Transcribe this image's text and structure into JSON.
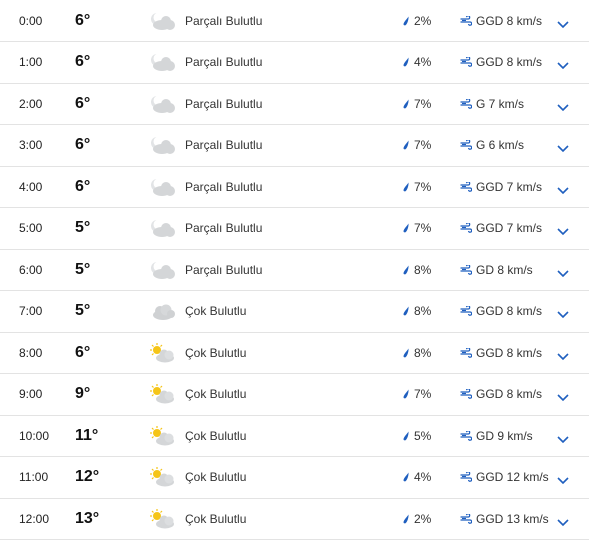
{
  "colors": {
    "accent": "#1f5fbf",
    "cloud": "#d4d6d8",
    "sun": "#f5c518",
    "divider": "#e3e3e3"
  },
  "rows": [
    {
      "time": "0:00",
      "temp": "6°",
      "icon": "partly-cloudy-night-icon",
      "condition": "Parçalı Bulutlu",
      "rain": "2%",
      "wind": "GGD 8 km/s"
    },
    {
      "time": "1:00",
      "temp": "6°",
      "icon": "partly-cloudy-night-icon",
      "condition": "Parçalı Bulutlu",
      "rain": "4%",
      "wind": "GGD 8 km/s"
    },
    {
      "time": "2:00",
      "temp": "6°",
      "icon": "partly-cloudy-night-icon",
      "condition": "Parçalı Bulutlu",
      "rain": "7%",
      "wind": "G 7 km/s"
    },
    {
      "time": "3:00",
      "temp": "6°",
      "icon": "partly-cloudy-night-icon",
      "condition": "Parçalı Bulutlu",
      "rain": "7%",
      "wind": "G 6 km/s"
    },
    {
      "time": "4:00",
      "temp": "6°",
      "icon": "partly-cloudy-night-icon",
      "condition": "Parçalı Bulutlu",
      "rain": "7%",
      "wind": "GGD 7 km/s"
    },
    {
      "time": "5:00",
      "temp": "5°",
      "icon": "partly-cloudy-night-icon",
      "condition": "Parçalı Bulutlu",
      "rain": "7%",
      "wind": "GGD 7 km/s"
    },
    {
      "time": "6:00",
      "temp": "5°",
      "icon": "partly-cloudy-night-icon",
      "condition": "Parçalı Bulutlu",
      "rain": "8%",
      "wind": "GD 8 km/s"
    },
    {
      "time": "7:00",
      "temp": "5°",
      "icon": "cloudy-icon",
      "condition": "Çok Bulutlu",
      "rain": "8%",
      "wind": "GGD 8 km/s"
    },
    {
      "time": "8:00",
      "temp": "6°",
      "icon": "mostly-cloudy-day-icon",
      "condition": "Çok Bulutlu",
      "rain": "8%",
      "wind": "GGD 8 km/s"
    },
    {
      "time": "9:00",
      "temp": "9°",
      "icon": "mostly-cloudy-day-icon",
      "condition": "Çok Bulutlu",
      "rain": "7%",
      "wind": "GGD 8 km/s"
    },
    {
      "time": "10:00",
      "temp": "11°",
      "icon": "mostly-cloudy-day-icon",
      "condition": "Çok Bulutlu",
      "rain": "5%",
      "wind": "GD 9 km/s"
    },
    {
      "time": "11:00",
      "temp": "12°",
      "icon": "mostly-cloudy-day-icon",
      "condition": "Çok Bulutlu",
      "rain": "4%",
      "wind": "GGD 12 km/s"
    },
    {
      "time": "12:00",
      "temp": "13°",
      "icon": "mostly-cloudy-day-icon",
      "condition": "Çok Bulutlu",
      "rain": "2%",
      "wind": "GGD 13 km/s"
    }
  ]
}
